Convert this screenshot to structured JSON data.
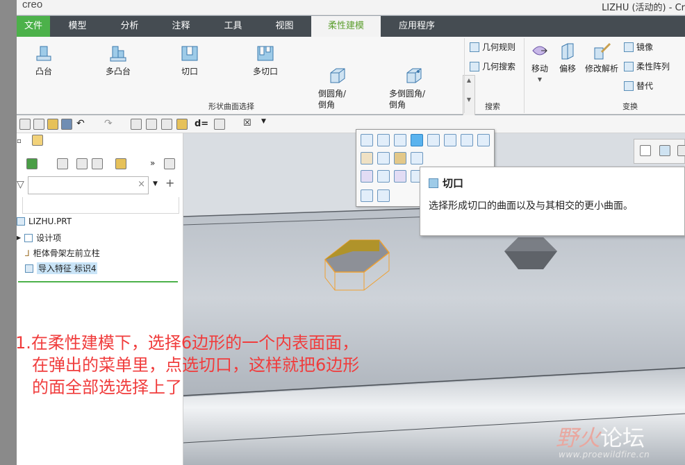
{
  "title_bar": {
    "logo": "creo",
    "window_title": "LIZHU (活动的) - Cr"
  },
  "tabs": [
    {
      "label": "文件"
    },
    {
      "label": "模型"
    },
    {
      "label": "分析"
    },
    {
      "label": "注释"
    },
    {
      "label": "工具"
    },
    {
      "label": "视图"
    },
    {
      "label": "柔性建模"
    },
    {
      "label": "应用程序"
    }
  ],
  "active_tab": "柔性建模",
  "ribbon": {
    "shape_group": {
      "label": "形状曲面选择",
      "buttons": [
        "凸台",
        "多凸台",
        "切口",
        "多切口",
        "倒圆角/\n倒角",
        "多倒圆角/\n倒角"
      ]
    },
    "search_group": {
      "label": "搜索",
      "buttons": [
        "几何规则",
        "几何搜索"
      ]
    },
    "transform_group": {
      "label": "变换",
      "buttons": [
        "移动",
        "偏移",
        "修改解析"
      ],
      "small_buttons": [
        "镜像",
        "柔性阵列",
        "替代"
      ]
    }
  },
  "model_tree": {
    "root": "LIZHU.PRT",
    "items": [
      "设计项",
      "柜体骨架左前立柱",
      "导入特征 标识4"
    ]
  },
  "tooltip": {
    "title": "切口",
    "description": "选择形成切口的曲面以及与其相交的更小曲面。"
  },
  "annotation": {
    "line1": "1.在柔性建模下，选择6边形的一个内表面面，",
    "line2": "在弹出的菜单里，点选切口，这样就把6边形",
    "line3": "的面全部选选择上了"
  },
  "watermark": {
    "part1": "野火",
    "part2": "论坛",
    "url": "www.proewildfire.cn"
  },
  "colors": {
    "file_tab": "#4cb14a",
    "active_tab_text": "#5d9f2f",
    "annotation": "#f03c3c",
    "highlight_face": "#b99a2e"
  }
}
